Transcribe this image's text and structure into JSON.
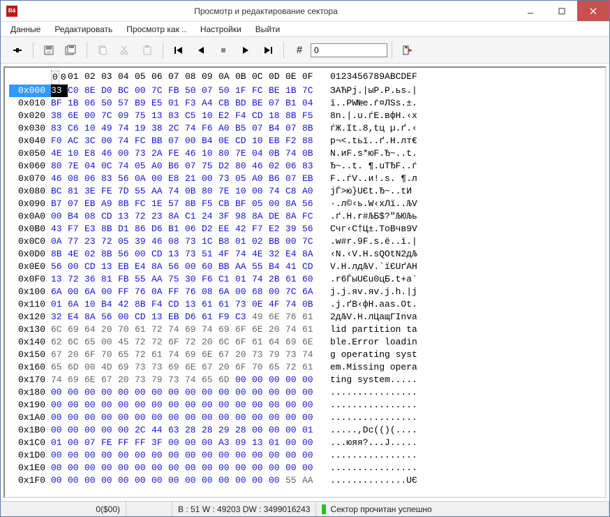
{
  "window": {
    "title": "Просмотр и редактирование сектора",
    "app_icon_text": "R4"
  },
  "menu": {
    "items": [
      "Данные",
      "Редактировать",
      "Просмотр как ..",
      "Настройки",
      "Выйти"
    ]
  },
  "toolbar": {
    "icons": [
      "pin-icon",
      "sep",
      "save-icon",
      "save-all-icon",
      "sep",
      "copy-icon",
      "cut-icon",
      "paste-icon",
      "sep",
      "first-icon",
      "prev-icon",
      "stop-icon",
      "next-icon",
      "last-icon",
      "sep",
      "hash-icon"
    ],
    "goto_value": "0",
    "run_icon": "exit-icon"
  },
  "hex": {
    "header": [
      "00",
      "01",
      "02",
      "03",
      "04",
      "05",
      "06",
      "07",
      "08",
      "09",
      "0A",
      "0B",
      "0C",
      "0D",
      "0E",
      "0F"
    ],
    "ascii_header": "0123456789ABCDEF",
    "rows": [
      {
        "addr": "0x000",
        "b": [
          "33",
          "C0",
          "8E",
          "D0",
          "BC",
          "00",
          "7C",
          "FB",
          "50",
          "07",
          "50",
          "1F",
          "FC",
          "BE",
          "1B",
          "7C"
        ],
        "a": "ЗАЋРј.|ыР.Р.ьѕ.|"
      },
      {
        "addr": "0x010",
        "b": [
          "BF",
          "1B",
          "06",
          "50",
          "57",
          "B9",
          "E5",
          "01",
          "F3",
          "A4",
          "CB",
          "BD",
          "BE",
          "07",
          "B1",
          "04"
        ],
        "a": "ї..PW№е.ѓ¤ЛЅѕ.±."
      },
      {
        "addr": "0x020",
        "b": [
          "38",
          "6E",
          "00",
          "7C",
          "09",
          "75",
          "13",
          "83",
          "C5",
          "10",
          "E2",
          "F4",
          "CD",
          "18",
          "8B",
          "F5"
        ],
        "a": "8n.|.u.ѓЕ.вфН.‹х"
      },
      {
        "addr": "0x030",
        "b": [
          "83",
          "C6",
          "10",
          "49",
          "74",
          "19",
          "38",
          "2C",
          "74",
          "F6",
          "A0",
          "B5",
          "07",
          "B4",
          "07",
          "8B"
        ],
        "a": "ѓЖ.It.8,tц µ.ґ.‹"
      },
      {
        "addr": "0x040",
        "b": [
          "F0",
          "AC",
          "3C",
          "00",
          "74",
          "FC",
          "BB",
          "07",
          "00",
          "B4",
          "0E",
          "CD",
          "10",
          "EB",
          "F2",
          "88"
        ],
        "a": "р¬<.tьї..ґ.Н.лт€"
      },
      {
        "addr": "0x050",
        "b": [
          "4E",
          "10",
          "E8",
          "46",
          "00",
          "73",
          "2A",
          "FE",
          "46",
          "10",
          "80",
          "7E",
          "04",
          "0B",
          "74",
          "0B"
        ],
        "a": "N.иF.s*юF.Ђ~..t."
      },
      {
        "addr": "0x060",
        "b": [
          "80",
          "7E",
          "04",
          "0C",
          "74",
          "05",
          "A0",
          "B6",
          "07",
          "75",
          "D2",
          "80",
          "46",
          "02",
          "06",
          "83"
        ],
        "a": "Ђ~..t. ¶.uТЂF..ѓ"
      },
      {
        "addr": "0x070",
        "b": [
          "46",
          "08",
          "06",
          "83",
          "56",
          "0A",
          "00",
          "E8",
          "21",
          "00",
          "73",
          "05",
          "A0",
          "B6",
          "07",
          "EB"
        ],
        "a": "F..ѓV..и!.s. ¶.л"
      },
      {
        "addr": "0x080",
        "b": [
          "BC",
          "81",
          "3E",
          "FE",
          "7D",
          "55",
          "AA",
          "74",
          "0B",
          "80",
          "7E",
          "10",
          "00",
          "74",
          "C8",
          "A0"
        ],
        "a": "јЃ>ю}UЄt.Ђ~..tИ "
      },
      {
        "addr": "0x090",
        "b": [
          "B7",
          "07",
          "EB",
          "A9",
          "8B",
          "FC",
          "1E",
          "57",
          "8B",
          "F5",
          "CB",
          "BF",
          "05",
          "00",
          "8A",
          "56"
        ],
        "a": "·.л©‹ь.W‹хЛї..ЉV"
      },
      {
        "addr": "0x0A0",
        "b": [
          "00",
          "B4",
          "08",
          "CD",
          "13",
          "72",
          "23",
          "8A",
          "C1",
          "24",
          "3F",
          "98",
          "8A",
          "DE",
          "8A",
          "FC"
        ],
        "a": ".ґ.Н.r#ЉБ$?\"ЉЮЉь"
      },
      {
        "addr": "0x0B0",
        "b": [
          "43",
          "F7",
          "E3",
          "8B",
          "D1",
          "86",
          "D6",
          "B1",
          "06",
          "D2",
          "EE",
          "42",
          "F7",
          "E2",
          "39",
          "56"
        ],
        "a": "Cчг‹С†Ц±.ТоBчв9V"
      },
      {
        "addr": "0x0C0",
        "b": [
          "0A",
          "77",
          "23",
          "72",
          "05",
          "39",
          "46",
          "08",
          "73",
          "1C",
          "B8",
          "01",
          "02",
          "BB",
          "00",
          "7C"
        ],
        "a": ".w#r.9F.s.ё..ї.|"
      },
      {
        "addr": "0x0D0",
        "b": [
          "8B",
          "4E",
          "02",
          "8B",
          "56",
          "00",
          "CD",
          "13",
          "73",
          "51",
          "4F",
          "74",
          "4E",
          "32",
          "E4",
          "8A"
        ],
        "a": "‹N.‹V.Н.sQOtN2дЉ"
      },
      {
        "addr": "0x0E0",
        "b": [
          "56",
          "00",
          "CD",
          "13",
          "EB",
          "E4",
          "8A",
          "56",
          "00",
          "60",
          "BB",
          "AA",
          "55",
          "B4",
          "41",
          "CD"
        ],
        "a": "V.Н.лдЉV.`їЄUґAН"
      },
      {
        "addr": "0x0F0",
        "b": [
          "13",
          "72",
          "36",
          "81",
          "FB",
          "55",
          "AA",
          "75",
          "30",
          "F6",
          "C1",
          "01",
          "74",
          "2B",
          "61",
          "60"
        ],
        "a": ".r6ЃыUЄu0цБ.t+a`"
      },
      {
        "addr": "0x100",
        "b": [
          "6A",
          "00",
          "6A",
          "00",
          "FF",
          "76",
          "0A",
          "FF",
          "76",
          "08",
          "6A",
          "00",
          "68",
          "00",
          "7C",
          "6A"
        ],
        "a": "j.j.яv.яv.j.h.|j"
      },
      {
        "addr": "0x110",
        "b": [
          "01",
          "6A",
          "10",
          "B4",
          "42",
          "8B",
          "F4",
          "CD",
          "13",
          "61",
          "61",
          "73",
          "0E",
          "4F",
          "74",
          "0B"
        ],
        "a": ".j.ґB‹фН.aas.Ot."
      },
      {
        "addr": "0x120",
        "b": [
          "32",
          "E4",
          "8A",
          "56",
          "00",
          "CD",
          "13",
          "EB",
          "D6",
          "61",
          "F9",
          "C3",
          "49",
          "6E",
          "76",
          "61"
        ],
        "a": "2дЉV.Н.лЦaщГInva"
      },
      {
        "addr": "0x130",
        "b": [
          "6C",
          "69",
          "64",
          "20",
          "70",
          "61",
          "72",
          "74",
          "69",
          "74",
          "69",
          "6F",
          "6E",
          "20",
          "74",
          "61"
        ],
        "a": "lid partition ta"
      },
      {
        "addr": "0x140",
        "b": [
          "62",
          "6C",
          "65",
          "00",
          "45",
          "72",
          "72",
          "6F",
          "72",
          "20",
          "6C",
          "6F",
          "61",
          "64",
          "69",
          "6E"
        ],
        "a": "ble.Error loadin"
      },
      {
        "addr": "0x150",
        "b": [
          "67",
          "20",
          "6F",
          "70",
          "65",
          "72",
          "61",
          "74",
          "69",
          "6E",
          "67",
          "20",
          "73",
          "79",
          "73",
          "74"
        ],
        "a": "g operating syst"
      },
      {
        "addr": "0x160",
        "b": [
          "65",
          "6D",
          "00",
          "4D",
          "69",
          "73",
          "73",
          "69",
          "6E",
          "67",
          "20",
          "6F",
          "70",
          "65",
          "72",
          "61"
        ],
        "a": "em.Missing opera"
      },
      {
        "addr": "0x170",
        "b": [
          "74",
          "69",
          "6E",
          "67",
          "20",
          "73",
          "79",
          "73",
          "74",
          "65",
          "6D",
          "00",
          "00",
          "00",
          "00",
          "00"
        ],
        "a": "ting system....."
      },
      {
        "addr": "0x180",
        "b": [
          "00",
          "00",
          "00",
          "00",
          "00",
          "00",
          "00",
          "00",
          "00",
          "00",
          "00",
          "00",
          "00",
          "00",
          "00",
          "00"
        ],
        "a": "................"
      },
      {
        "addr": "0x190",
        "b": [
          "00",
          "00",
          "00",
          "00",
          "00",
          "00",
          "00",
          "00",
          "00",
          "00",
          "00",
          "00",
          "00",
          "00",
          "00",
          "00"
        ],
        "a": "................"
      },
      {
        "addr": "0x1A0",
        "b": [
          "00",
          "00",
          "00",
          "00",
          "00",
          "00",
          "00",
          "00",
          "00",
          "00",
          "00",
          "00",
          "00",
          "00",
          "00",
          "00"
        ],
        "a": "................"
      },
      {
        "addr": "0x1B0",
        "b": [
          "00",
          "00",
          "00",
          "00",
          "00",
          "2C",
          "44",
          "63",
          "28",
          "28",
          "29",
          "28",
          "00",
          "00",
          "00",
          "01"
        ],
        "a": ".....,Dc(()(...."
      },
      {
        "addr": "0x1C0",
        "b": [
          "01",
          "00",
          "07",
          "FE",
          "FF",
          "FF",
          "3F",
          "00",
          "00",
          "00",
          "A3",
          "09",
          "13",
          "01",
          "00",
          "00"
        ],
        "a": "...юяя?...Ј....."
      },
      {
        "addr": "0x1D0",
        "b": [
          "00",
          "00",
          "00",
          "00",
          "00",
          "00",
          "00",
          "00",
          "00",
          "00",
          "00",
          "00",
          "00",
          "00",
          "00",
          "00"
        ],
        "a": "................"
      },
      {
        "addr": "0x1E0",
        "b": [
          "00",
          "00",
          "00",
          "00",
          "00",
          "00",
          "00",
          "00",
          "00",
          "00",
          "00",
          "00",
          "00",
          "00",
          "00",
          "00"
        ],
        "a": "................"
      },
      {
        "addr": "0x1F0",
        "b": [
          "00",
          "00",
          "00",
          "00",
          "00",
          "00",
          "00",
          "00",
          "00",
          "00",
          "00",
          "00",
          "00",
          "00",
          "55",
          "AA"
        ],
        "a": "..............UЄ"
      }
    ]
  },
  "status": {
    "pos": "0($00)",
    "bw": "B : 51 W : 49203 DW : 3499016243",
    "msg": "Сектор прочитан успешно"
  },
  "dim_map": {
    "0x130": true,
    "0x140": true,
    "0x150": true,
    "0x160": true
  }
}
